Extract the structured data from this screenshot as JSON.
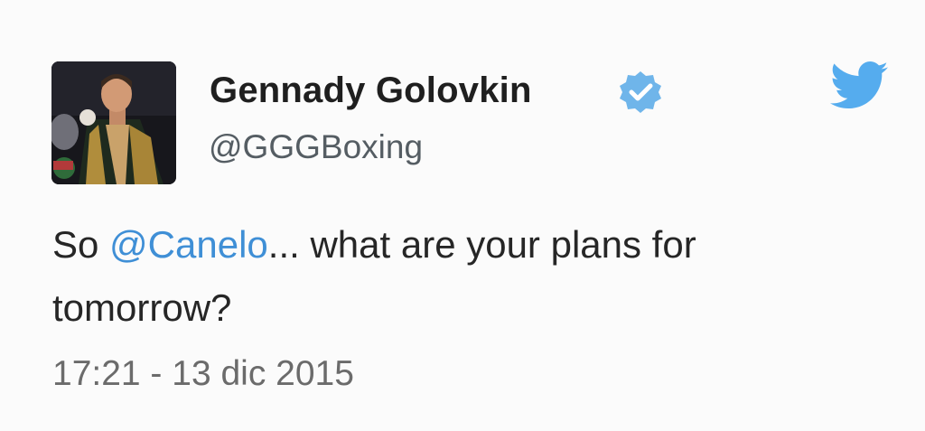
{
  "author": {
    "name": "Gennady Golovkin",
    "handle": "@GGGBoxing",
    "verified_icon": "verified-badge-icon",
    "avatar_icon": "profile-photo"
  },
  "tweet": {
    "prefix": "So ",
    "mention": "@Canelo",
    "suffix_line1": "... what are your plans for",
    "suffix_line2": "tomorrow?",
    "timestamp": "17:21 - 13 dic 2015"
  },
  "brand": {
    "icon": "twitter-bird-icon",
    "accent": "#55acee",
    "mention_color": "#3f8fd6"
  }
}
